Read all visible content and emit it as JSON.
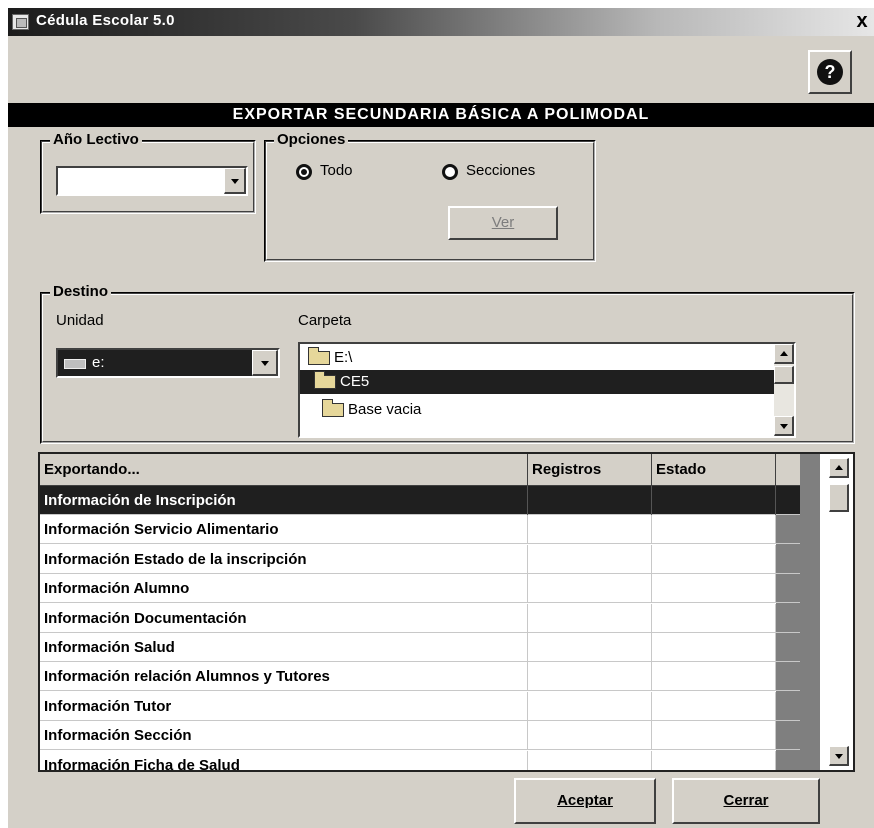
{
  "window": {
    "title": "Cédula Escolar 5.0",
    "close_symbol": "x"
  },
  "help_button": {
    "symbol": "?"
  },
  "banner": {
    "text": "EXPORTAR SECUNDARIA BÁSICA A POLIMODAL"
  },
  "year_group": {
    "legend": "Año Lectivo",
    "value": ""
  },
  "options_group": {
    "legend": "Opciones",
    "todo_label": "Todo",
    "secciones_label": "Secciones",
    "selected": "Todo",
    "ver_label": "Ver"
  },
  "destino_group": {
    "legend": "Destino",
    "unidad_label": "Unidad",
    "unidad_value": "e:",
    "carpeta_label": "Carpeta",
    "folders": [
      {
        "name": "E:\\",
        "icon": "open-folder-icon",
        "selected": false
      },
      {
        "name": "CE5",
        "icon": "open-folder-icon",
        "selected": true
      },
      {
        "name": "Base vacia",
        "icon": "folder-icon",
        "selected": false
      }
    ]
  },
  "export_grid": {
    "headers": [
      "Exportando...",
      "Registros",
      "Estado"
    ],
    "rows": [
      {
        "item": "Información de Inscripción",
        "registros": "",
        "estado": "",
        "selected": true
      },
      {
        "item": "Información Servicio Alimentario",
        "registros": "",
        "estado": ""
      },
      {
        "item": "Información Estado de la inscripción",
        "registros": "",
        "estado": ""
      },
      {
        "item": "Información Alumno",
        "registros": "",
        "estado": ""
      },
      {
        "item": "Información Documentación",
        "registros": "",
        "estado": ""
      },
      {
        "item": "Información Salud",
        "registros": "",
        "estado": ""
      },
      {
        "item": "Información relación Alumnos y Tutores",
        "registros": "",
        "estado": ""
      },
      {
        "item": "Información Tutor",
        "registros": "",
        "estado": ""
      },
      {
        "item": "Información Sección",
        "registros": "",
        "estado": ""
      },
      {
        "item": "Información Ficha de Salud",
        "registros": "",
        "estado": ""
      }
    ]
  },
  "buttons": {
    "accept": "Aceptar",
    "close": "Cerrar"
  },
  "colors": {
    "window_bg": "#d4d0c8",
    "selection": "#1f1f1f",
    "banner": "#000000"
  }
}
